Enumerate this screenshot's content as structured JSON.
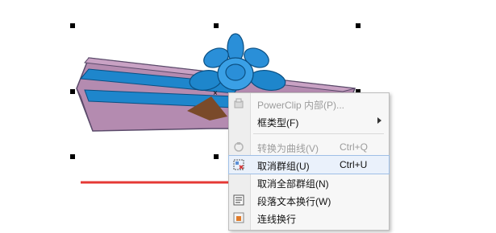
{
  "context_menu": {
    "items": [
      {
        "label": "PowerClip 内部(P)...",
        "shortcut": "",
        "disabled": true,
        "submenu": false,
        "icon": "powerclip-icon"
      },
      {
        "label": "框类型(F)",
        "shortcut": "",
        "disabled": false,
        "submenu": true,
        "icon": ""
      },
      {
        "label": "转换为曲线(V)",
        "shortcut": "Ctrl+Q",
        "disabled": true,
        "submenu": false,
        "icon": "convert-to-curves-icon"
      },
      {
        "label": "取消群组(U)",
        "shortcut": "Ctrl+U",
        "disabled": false,
        "submenu": false,
        "icon": "ungroup-icon",
        "highlighted": true
      },
      {
        "label": "取消全部群组(N)",
        "shortcut": "",
        "disabled": false,
        "submenu": false,
        "icon": ""
      },
      {
        "label": "段落文本换行(W)",
        "shortcut": "",
        "disabled": false,
        "submenu": false,
        "icon": "paragraph-wrap-icon"
      },
      {
        "label": "连线换行",
        "shortcut": "",
        "disabled": false,
        "submenu": false,
        "icon": "connector-wrap-icon"
      }
    ]
  },
  "colors": {
    "gift_box": "#b48bb0",
    "ribbon": "#1e86cc",
    "bow": "#2a8fd8",
    "arrow": "#e53935",
    "menu_bg": "#f7f7f7",
    "hover": "#eaf1fb"
  }
}
